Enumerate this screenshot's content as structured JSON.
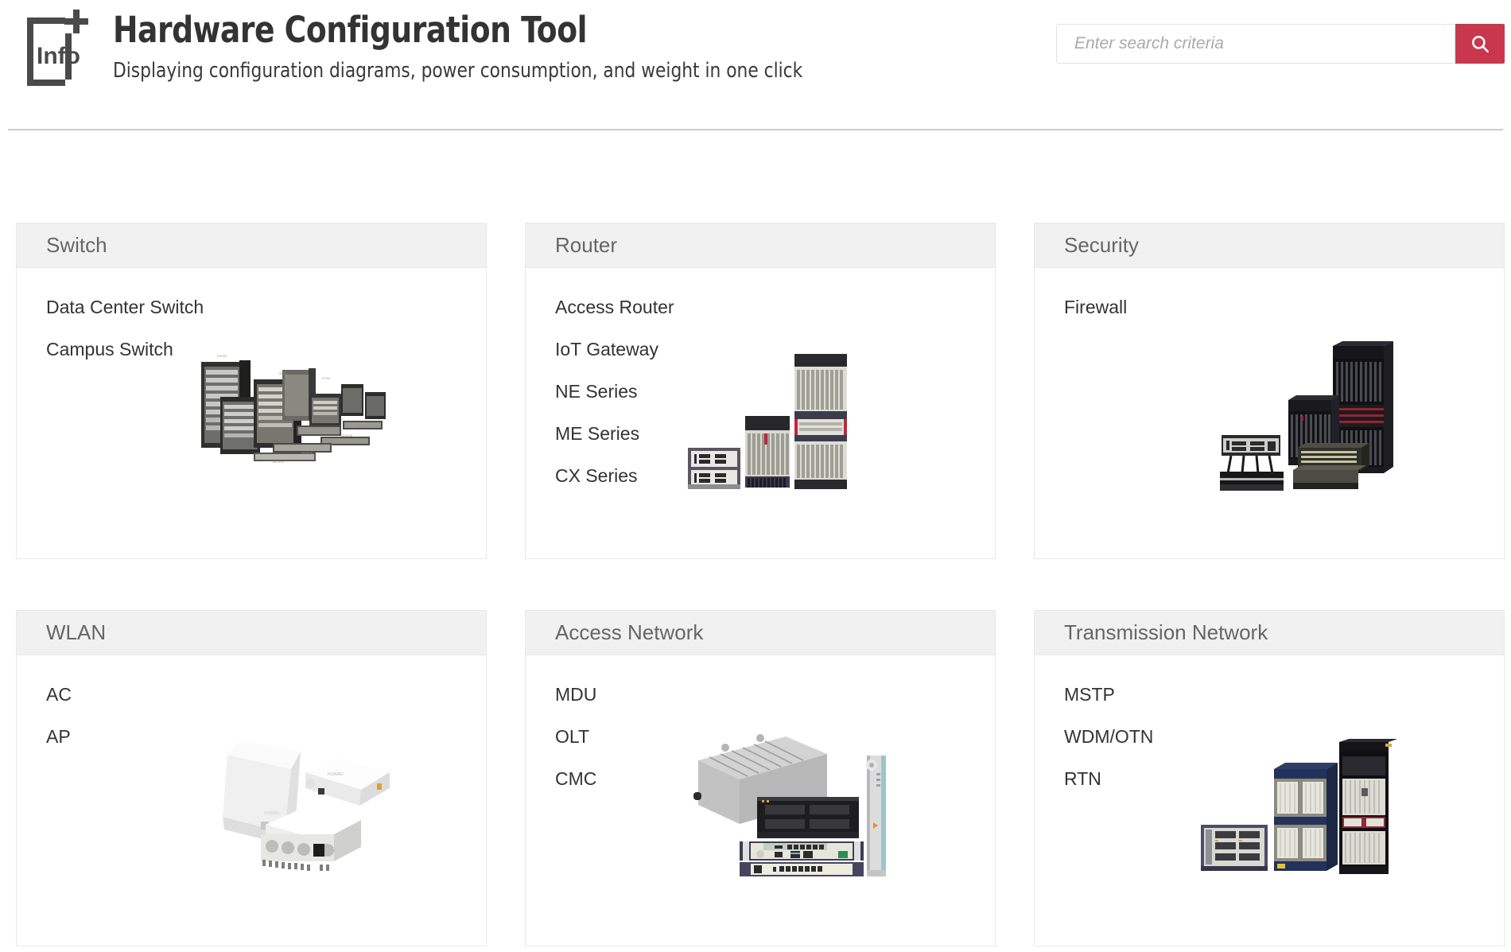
{
  "header": {
    "logo_text": "Info",
    "logo_plus": "+",
    "title": "Hardware Configuration Tool",
    "subtitle": "Displaying configuration diagrams, power consumption, and weight in one click",
    "search": {
      "placeholder": "Enter search criteria",
      "value": "",
      "button_icon": "search-icon",
      "button_color": "#c9374c"
    }
  },
  "colors": {
    "accent": "#c9374c",
    "card_header_bg": "#f1f1f1",
    "card_border": "#e8e8e8",
    "card_title": "#666666",
    "link": "#333333",
    "annotation": "#e8112d"
  },
  "cards": [
    {
      "title": "Switch",
      "items": [
        "Data Center Switch",
        "Campus Switch"
      ],
      "image_name": "switch-product-family-photo"
    },
    {
      "title": "Router",
      "items": [
        "Access Router",
        "IoT Gateway",
        "NE Series",
        "ME Series",
        "CX Series"
      ],
      "image_name": "router-product-family-photo"
    },
    {
      "title": "Security",
      "items": [
        "Firewall"
      ],
      "image_name": "security-product-family-photo"
    },
    {
      "title": "WLAN",
      "items": [
        "AC",
        "AP"
      ],
      "image_name": "wlan-product-family-photo"
    },
    {
      "title": "Access Network",
      "items": [
        "MDU",
        "OLT",
        "CMC"
      ],
      "image_name": "access-network-product-family-photo"
    },
    {
      "title": "Transmission Network",
      "items": [
        "MSTP",
        "WDM/OTN",
        "RTN"
      ],
      "image_name": "transmission-network-product-family-photo"
    }
  ],
  "annotation": {
    "target_label": "Campus Switch",
    "shape": "left-pointing-arrow",
    "color": "#e8112d"
  }
}
